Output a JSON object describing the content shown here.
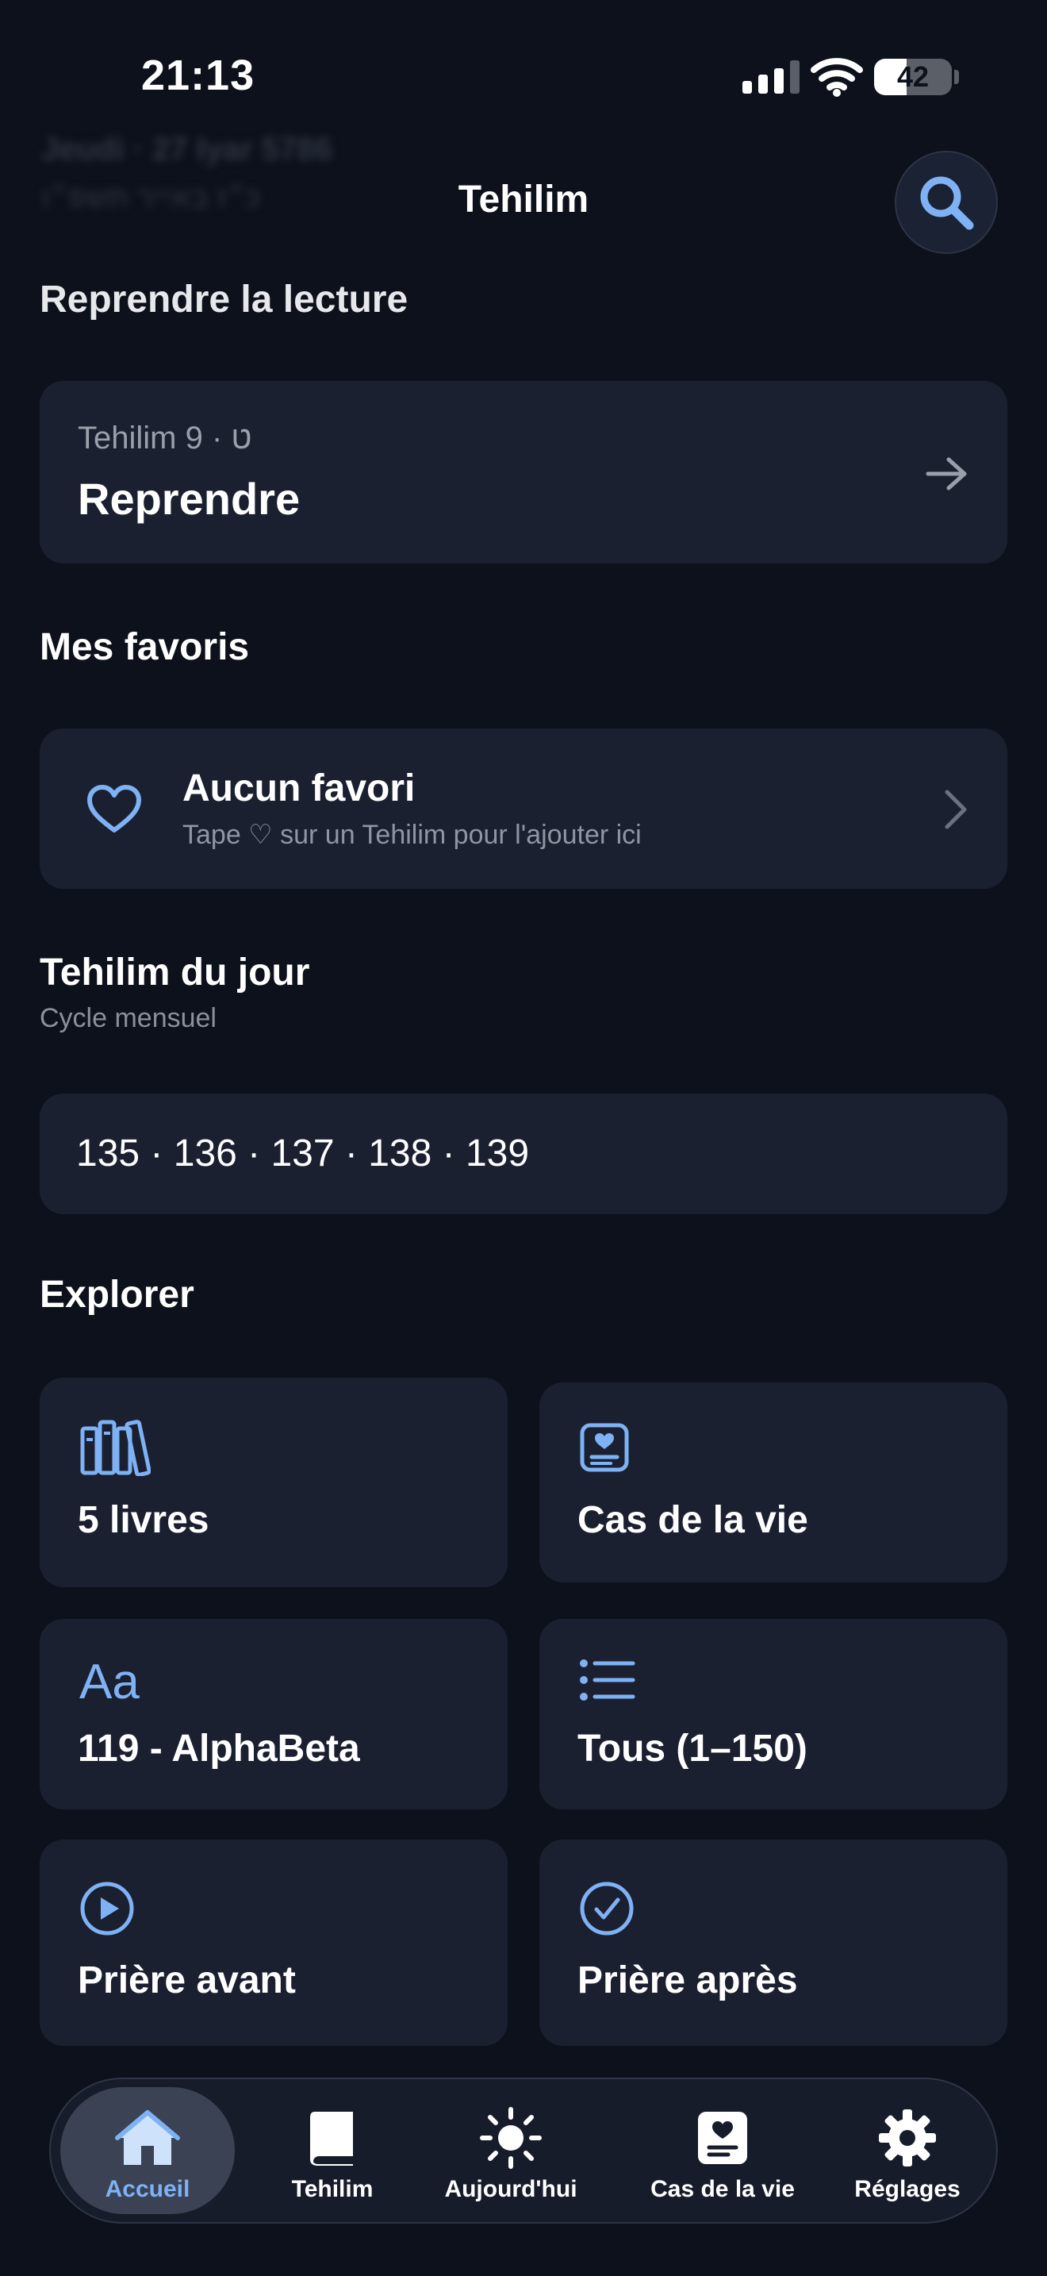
{
  "status_bar": {
    "time": "21:13",
    "battery": "42",
    "battery_level": 0.42
  },
  "header": {
    "blurred_date": "Jeudi · 27 Iyar 5786",
    "blurred_hebrew": "כ״ז באייר תשפ״ו",
    "title": "Tehilim"
  },
  "resume": {
    "section_title": "Reprendre la lecture",
    "subtitle": "Tehilim 9 · ט",
    "action": "Reprendre"
  },
  "favorites": {
    "section_title": "Mes favoris",
    "empty_title": "Aucun favori",
    "empty_hint": "Tape ♡ sur un Tehilim pour l'ajouter ici"
  },
  "daily": {
    "section_title": "Tehilim du jour",
    "section_subtitle": "Cycle mensuel",
    "chapters": "135 · 136 · 137 · 138 · 139"
  },
  "explore": {
    "section_title": "Explorer",
    "tiles": [
      {
        "label": "5 livres",
        "icon": "books-icon"
      },
      {
        "label": "Cas de la vie",
        "icon": "heart-document-icon"
      },
      {
        "label": "119 - AlphaBeta",
        "icon": "alphabet-icon"
      },
      {
        "label": "Tous (1–150)",
        "icon": "list-icon"
      },
      {
        "label": "Prière avant",
        "icon": "play-circle-icon"
      },
      {
        "label": "Prière après",
        "icon": "check-circle-icon"
      }
    ]
  },
  "tab_bar": {
    "items": [
      {
        "label": "Accueil",
        "icon": "house-icon",
        "active": true
      },
      {
        "label": "Tehilim",
        "icon": "book-icon",
        "active": false
      },
      {
        "label": "Aujourd'hui",
        "icon": "sun-icon",
        "active": false
      },
      {
        "label": "Cas de la vie",
        "icon": "heart-document-icon",
        "active": false
      },
      {
        "label": "Réglages",
        "icon": "gear-icon",
        "active": false
      }
    ]
  },
  "colors": {
    "background": "#0d111b",
    "card": "#1b2031",
    "accent": "#7eb2f4",
    "muted_text": "#8f95a2"
  }
}
